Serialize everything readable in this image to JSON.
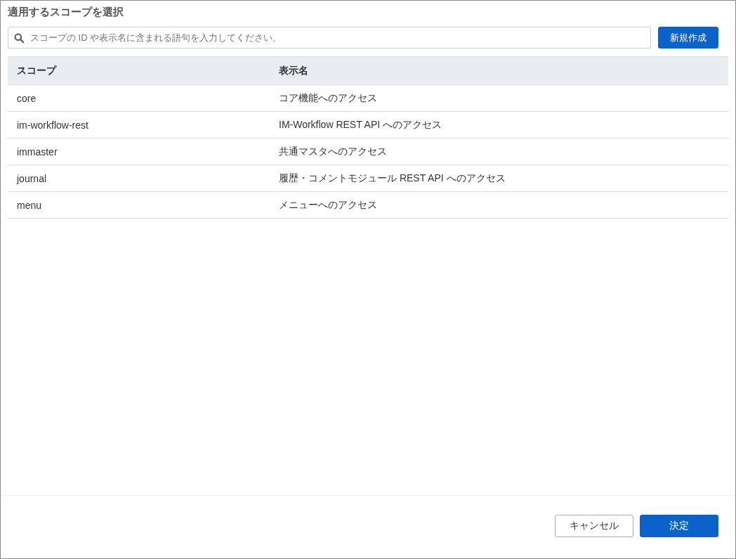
{
  "dialog": {
    "title": "適用するスコープを選択"
  },
  "search": {
    "placeholder": "スコープの ID や表示名に含まれる語句を入力してください。"
  },
  "create_button": "新規作成",
  "table": {
    "columns": [
      "スコープ",
      "表示名"
    ],
    "rows": [
      {
        "cells": [
          "core",
          "コア機能へのアクセス"
        ]
      },
      {
        "cells": [
          "im-workflow-rest",
          "IM-Workflow REST API へのアクセス"
        ]
      },
      {
        "cells": [
          "immaster",
          "共通マスタへのアクセス"
        ]
      },
      {
        "cells": [
          "journal",
          "履歴・コメントモジュール REST API へのアクセス"
        ]
      },
      {
        "cells": [
          "menu",
          "メニューへのアクセス"
        ]
      }
    ]
  },
  "buttons": [
    {
      "label": "キャンセル",
      "kind": "secondary"
    },
    {
      "label": "決定",
      "kind": "primary"
    }
  ]
}
